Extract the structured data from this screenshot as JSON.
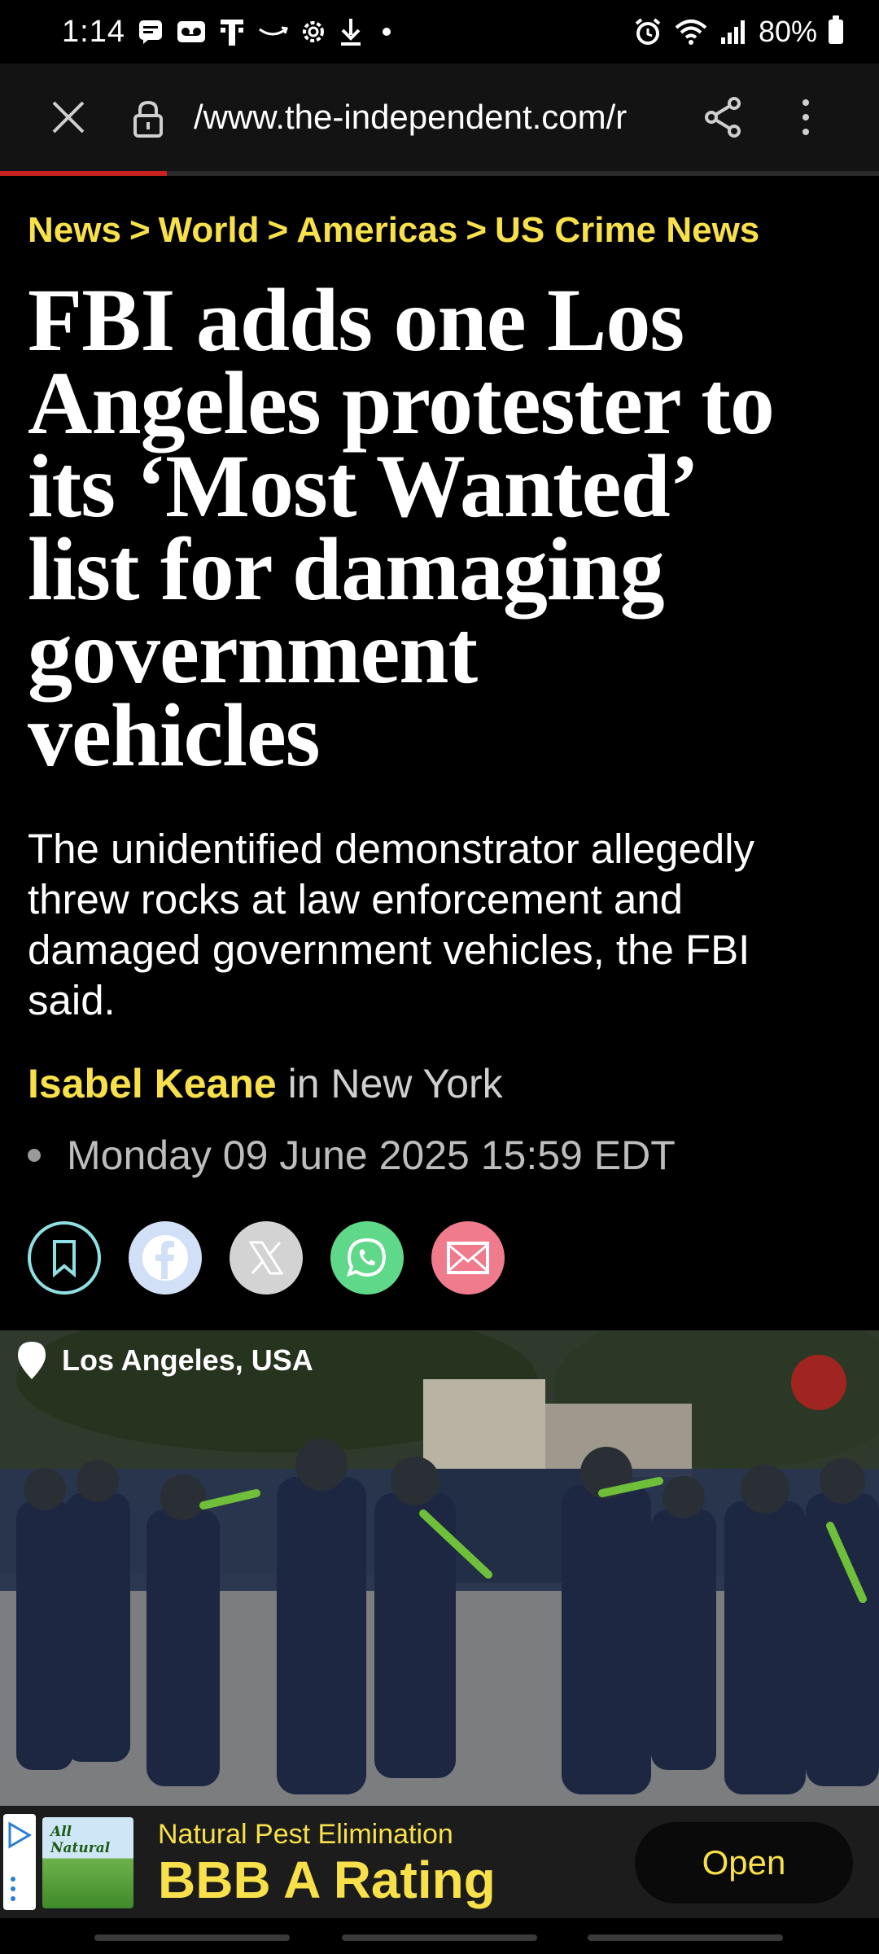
{
  "status_bar": {
    "time": "1:14",
    "battery": "80%",
    "left_icons": [
      "message-icon",
      "voicemail-icon",
      "t-mobile-icon",
      "amazon-icon",
      "settings-icon",
      "download-icon",
      "dot-icon"
    ],
    "right_icons": [
      "alarm-icon",
      "wifi-icon",
      "signal-icon",
      "battery-icon"
    ]
  },
  "browser": {
    "url": "/www.the-independent.com/r",
    "progress": 0.19
  },
  "article": {
    "breadcrumb": [
      "News",
      "World",
      "Americas",
      "US Crime News"
    ],
    "breadcrumb_separator": ">",
    "headline_lines": [
      "FBI adds one Los",
      "Angeles protester to",
      "its ‘Most Wanted’",
      "list for damaging",
      "government",
      "vehicles"
    ],
    "standfirst_lines": [
      "The unidentified demonstrator allegedly",
      "threw rocks at law enforcement and",
      "damaged government vehicles, the FBI",
      "said."
    ],
    "author": "Isabel Keane",
    "location": " in New York",
    "date": "Monday 09 June 2025 15:59 EDT"
  },
  "share": [
    "bookmark-icon",
    "facebook-icon",
    "x-icon",
    "whatsapp-icon",
    "email-icon"
  ],
  "photo": {
    "location": "Los Angeles, USA"
  },
  "ad": {
    "image_text": "All Natural",
    "subtitle": "Natural Pest Elimination",
    "title": "BBB A Rating",
    "cta": "Open"
  },
  "colors": {
    "accent_yellow": "#f7e04a",
    "background": "#000000",
    "toolbar": "#131313",
    "progress_red": "#c8231f"
  }
}
